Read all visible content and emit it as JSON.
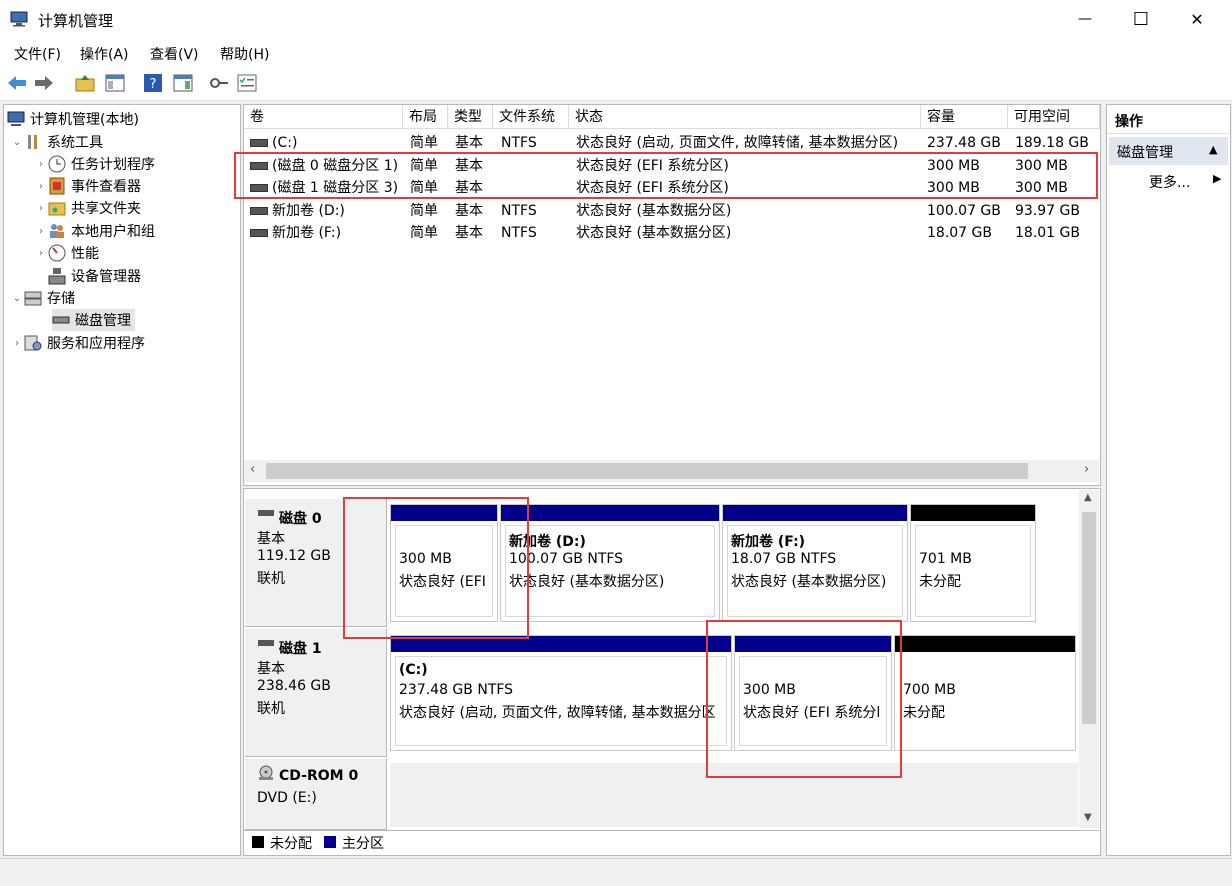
{
  "window": {
    "title": "计算机管理",
    "controls": {
      "minimize": "—",
      "maximize": "☐",
      "close": "✕"
    }
  },
  "menu": [
    "文件(F)",
    "操作(A)",
    "查看(V)",
    "帮助(H)"
  ],
  "tree": {
    "root": "计算机管理(本地)",
    "system_tools": "系统工具",
    "task_scheduler": "任务计划程序",
    "event_viewer": "事件查看器",
    "shared_folders": "共享文件夹",
    "local_users": "本地用户和组",
    "performance": "性能",
    "device_manager": "设备管理器",
    "storage": "存储",
    "disk_management": "磁盘管理",
    "services": "服务和应用程序"
  },
  "volume_table": {
    "columns": [
      "卷",
      "布局",
      "类型",
      "文件系统",
      "状态",
      "容量",
      "可用空间"
    ],
    "rows": [
      [
        "(C:)",
        "简单",
        "基本",
        "NTFS",
        "状态良好 (启动, 页面文件, 故障转储, 基本数据分区)",
        "237.48 GB",
        "189.18 GB"
      ],
      [
        "(磁盘 0 磁盘分区 1)",
        "简单",
        "基本",
        "",
        "状态良好 (EFI 系统分区)",
        "300 MB",
        "300 MB"
      ],
      [
        "(磁盘 1 磁盘分区 3)",
        "简单",
        "基本",
        "",
        "状态良好 (EFI 系统分区)",
        "300 MB",
        "300 MB"
      ],
      [
        "新加卷 (D:)",
        "简单",
        "基本",
        "NTFS",
        "状态良好 (基本数据分区)",
        "100.07 GB",
        "93.97 GB"
      ],
      [
        "新加卷 (F:)",
        "简单",
        "基本",
        "NTFS",
        "状态良好 (基本数据分区)",
        "18.07 GB",
        "18.01 GB"
      ]
    ]
  },
  "disks": {
    "disk0": {
      "name": "磁盘 0",
      "type": "基本",
      "size": "119.12 GB",
      "status": "联机",
      "p1": {
        "size": "300 MB",
        "status": "状态良好 (EFI"
      },
      "p2": {
        "name": "新加卷  (D:)",
        "size": "100.07 GB NTFS",
        "status": "状态良好 (基本数据分区)"
      },
      "p3": {
        "name": "新加卷  (F:)",
        "size": "18.07 GB NTFS",
        "status": "状态良好 (基本数据分区)"
      },
      "p4": {
        "size": "701 MB",
        "status": "未分配"
      }
    },
    "disk1": {
      "name": "磁盘 1",
      "type": "基本",
      "size": "238.46 GB",
      "status": "联机",
      "p1": {
        "name": "(C:)",
        "size": "237.48 GB NTFS",
        "status": "状态良好 (启动, 页面文件, 故障转储, 基本数据分区"
      },
      "p2": {
        "size": "300 MB",
        "status": "状态良好 (EFI 系统分l"
      },
      "p3": {
        "size": "700 MB",
        "status": "未分配"
      }
    },
    "cdrom": {
      "name": "CD-ROM 0",
      "drive": "DVD (E:)"
    }
  },
  "legend": {
    "unallocated": "未分配",
    "primary": "主分区"
  },
  "actions": {
    "header": "操作",
    "section": "磁盘管理",
    "more": "更多..."
  },
  "colors": {
    "primary_partition": "#00008b",
    "unallocated": "#000000",
    "highlight": "#e03c3c"
  }
}
